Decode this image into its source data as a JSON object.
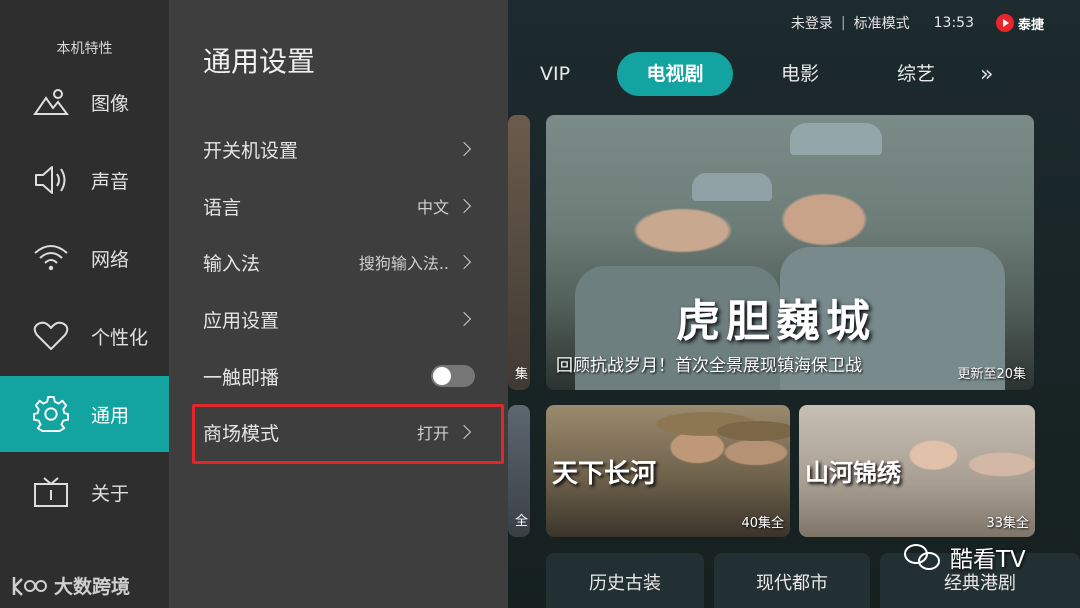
{
  "status_bar": {
    "login": "未登录",
    "mode": "标准模式",
    "time": "13:53",
    "brand": "泰捷"
  },
  "tabs": [
    {
      "label": "VIP"
    },
    {
      "label": "电视剧",
      "active": true
    },
    {
      "label": "电影"
    },
    {
      "label": "综艺"
    }
  ],
  "tab_more": "»",
  "hero": {
    "title": "虎胆巍城",
    "subtitle": "回顾抗战岁月！首次全景展现镇海保卫战",
    "episodes": "更新至20集",
    "peek_episodes": "集"
  },
  "cards": [
    {
      "title": "天下长河",
      "episodes": "40集全"
    },
    {
      "title": "山河锦绣",
      "episodes": "33集全"
    }
  ],
  "peek_card_episodes": "全",
  "categories": [
    "历史古装",
    "现代都市",
    "经典港剧"
  ],
  "watermark": "酷看TV",
  "rail": {
    "title": "本机特性",
    "items": [
      {
        "label": "图像",
        "icon": "image-icon"
      },
      {
        "label": "声音",
        "icon": "speaker-icon"
      },
      {
        "label": "网络",
        "icon": "wifi-icon"
      },
      {
        "label": "个性化",
        "icon": "heart-icon"
      },
      {
        "label": "通用",
        "icon": "gear-icon",
        "active": true
      },
      {
        "label": "关于",
        "icon": "tv-icon"
      }
    ],
    "bottom_logo": "大数跨境"
  },
  "panel": {
    "title": "通用设置",
    "rows": [
      {
        "label": "开关机设置",
        "value": ""
      },
      {
        "label": "语言",
        "value": "中文"
      },
      {
        "label": "输入法",
        "value": "搜狗输入法.."
      },
      {
        "label": "应用设置",
        "value": ""
      },
      {
        "label": "一触即播",
        "toggle": false
      },
      {
        "label": "商场模式",
        "value": "打开"
      }
    ]
  },
  "colors": {
    "accent": "#13a3a0",
    "highlight_border": "#e3262a",
    "panel_bg": "#3e3e3e",
    "rail_bg": "#2e2e2e"
  }
}
